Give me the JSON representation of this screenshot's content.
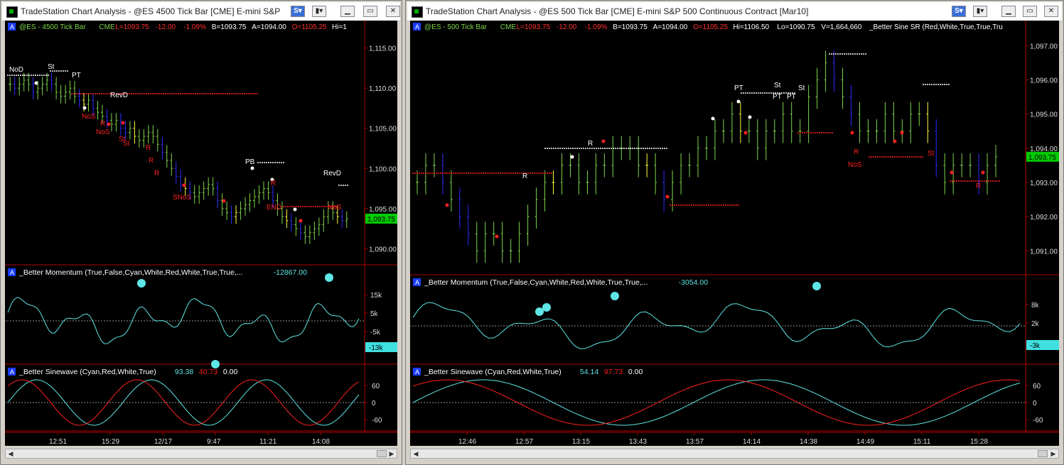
{
  "windows": [
    {
      "title": "TradeStation Chart Analysis - @ES 4500 Tick Bar [CME] E-mini S&P",
      "symbol": "@ES - 4500 Tick Bar",
      "exchange": "CME",
      "last": "L=1093.75",
      "chg": "-12.00",
      "pct": "-1.09%",
      "bid": "B=1093.75",
      "ask": "A=1094.00",
      "open": "O=1105.25",
      "high": "Hi=1",
      "volume": "",
      "indicator_label": "",
      "price_ticks": [
        "1,115.00",
        "1,110.00",
        "1,105.00",
        "1,100.00",
        "1,095.00",
        "1,090.00"
      ],
      "current_price": "1,093.75",
      "momentum_label": "_Better Momentum (True,False,Cyan,White,Red,White,True,True,...",
      "momentum_value": "-12867.00",
      "momentum_ticks": [
        "15k",
        "5k",
        "-5k"
      ],
      "momentum_current": "-13k",
      "sine_label": "_Better Sinewave (Cyan,Red,White,True)",
      "sine_v1": "93.38",
      "sine_v2": "40.73",
      "sine_v3": "0.00",
      "sine_ticks": [
        "60",
        "0",
        "-60"
      ],
      "time_labels": [
        "12:51",
        "15:29",
        "12/17",
        "9:47",
        "11:21",
        "14:08"
      ],
      "annotations": [
        "NoD",
        "St",
        "PT",
        "RevD",
        "NoS",
        "R",
        "NoS",
        "St",
        "St",
        "R",
        "R",
        "R",
        "SNoS",
        "PB",
        "R",
        "END",
        "NoS",
        "RevD"
      ],
      "chart_data": {
        "type": "bar",
        "bar_type": "4500 tick OHLC",
        "price_axis": [
          1088,
          1117
        ],
        "closes": [
          1110.5,
          1110.0,
          1110.5,
          1111.0,
          1110.5,
          1109.5,
          1110.0,
          1110.5,
          1111.0,
          1110.5,
          1109.5,
          1109.0,
          1109.5,
          1110.0,
          1109.0,
          1108.5,
          1108.0,
          1108.5,
          1107.5,
          1107.0,
          1106.5,
          1106.0,
          1105.5,
          1106.0,
          1105.0,
          1104.5,
          1105.0,
          1104.0,
          1103.5,
          1104.0,
          1104.5,
          1104.0,
          1103.0,
          1102.0,
          1101.0,
          1100.0,
          1099.0,
          1098.0,
          1097.5,
          1097.0,
          1096.5,
          1097.0,
          1097.5,
          1098.0,
          1097.5,
          1096.0,
          1095.0,
          1094.5,
          1094.0,
          1094.5,
          1095.0,
          1095.5,
          1096.0,
          1096.5,
          1097.0,
          1097.5,
          1097.0,
          1096.0,
          1095.0,
          1094.0,
          1093.5,
          1093.0,
          1092.5,
          1092.0,
          1091.5,
          1092.0,
          1092.5,
          1093.0,
          1094.0,
          1095.0,
          1094.5,
          1094.0,
          1093.5,
          1093.75
        ]
      }
    },
    {
      "title": "TradeStation Chart Analysis - @ES 500 Tick Bar [CME] E-mini S&P 500 Continuous Contract [Mar10]",
      "symbol": "@ES - 500 Tick Bar",
      "exchange": "CME",
      "last": "L=1093.75",
      "chg": "-12.00",
      "pct": "-1.09%",
      "bid": "B=1093.75",
      "ask": "A=1094.00",
      "open": "O=1105.25",
      "high": "Hi=1106.50",
      "low": "Lo=1090.75",
      "volume": "V=1,664,660",
      "indicator_label": "_Better Sine SR (Red,White,True,True,Tru",
      "price_ticks": [
        "1,097.00",
        "1,096.00",
        "1,095.00",
        "1,094.00",
        "1,093.00",
        "1,092.00",
        "1,091.00"
      ],
      "current_price": "1,093.75",
      "momentum_label": "_Better Momentum (True,False,Cyan,White,Red,White,True,True,...",
      "momentum_value": "-3054.00",
      "momentum_ticks": [
        "8k",
        "2k"
      ],
      "momentum_current": "-3k",
      "sine_label": "_Better Sinewave (Cyan,Red,White,True)",
      "sine_v1": "54.14",
      "sine_v2": "97.73",
      "sine_v3": "0.00",
      "sine_ticks": [
        "60",
        "0",
        "-60"
      ],
      "time_labels": [
        "12:46",
        "12:57",
        "13:15",
        "13:43",
        "13:57",
        "14:14",
        "14:38",
        "14:49",
        "15:11",
        "15:28"
      ],
      "annotations": [
        "R",
        "R",
        "PT",
        "St",
        "PT",
        "St",
        "PT",
        "R",
        "NoS",
        "St",
        "R"
      ],
      "chart_data": {
        "type": "bar",
        "bar_type": "500 tick OHLC",
        "price_axis": [
          1090.3,
          1097.4
        ],
        "closes": [
          1093.0,
          1093.5,
          1093.5,
          1093.0,
          1092.5,
          1092.0,
          1091.5,
          1091.0,
          1091.5,
          1091.5,
          1091.0,
          1091.0,
          1091.5,
          1092.0,
          1092.5,
          1093.0,
          1093.0,
          1093.5,
          1093.5,
          1093.0,
          1093.0,
          1093.5,
          1093.5,
          1094.0,
          1094.0,
          1094.0,
          1093.5,
          1093.5,
          1093.0,
          1092.5,
          1093.0,
          1093.5,
          1093.5,
          1094.0,
          1094.0,
          1094.5,
          1094.5,
          1095.0,
          1094.5,
          1094.5,
          1094.0,
          1094.5,
          1094.5,
          1095.0,
          1094.5,
          1094.5,
          1095.5,
          1096.0,
          1096.5,
          1096.0,
          1095.5,
          1095.0,
          1094.5,
          1094.5,
          1094.5,
          1095.0,
          1094.5,
          1094.5,
          1095.0,
          1095.0,
          1094.5,
          1093.5,
          1093.0,
          1093.5,
          1093.5,
          1093.5,
          1093.0,
          1093.5,
          1093.75
        ]
      }
    }
  ],
  "colors": {
    "up_bar": "#7fd64a",
    "down_bar": "#2b2bff",
    "neutral_bar": "#ffff40",
    "momentum_line": "#5fe6e6",
    "sine_line": "#5fe6e6",
    "lead_line": "#ff2020",
    "support_dots": "#ff2020",
    "resistance_dots": "#ffffff",
    "price_marker": "#00cc00"
  }
}
